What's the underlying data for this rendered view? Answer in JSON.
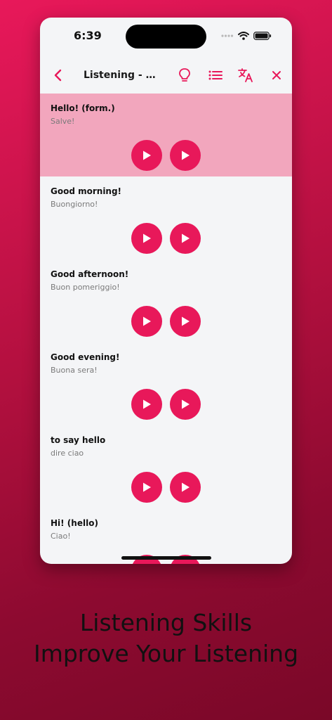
{
  "status": {
    "time": "6:39"
  },
  "nav": {
    "title": "Listening - To..."
  },
  "items": [
    {
      "phrase": "Hello! (form.)",
      "translation": "Salve!"
    },
    {
      "phrase": "Good morning!",
      "translation": "Buongiorno!"
    },
    {
      "phrase": "Good afternoon!",
      "translation": "Buon pomeriggio!"
    },
    {
      "phrase": "Good evening!",
      "translation": "Buona sera!"
    },
    {
      "phrase": "to say hello",
      "translation": "dire ciao"
    },
    {
      "phrase": "Hi! (hello)",
      "translation": "Ciao!"
    }
  ],
  "caption": {
    "line1": "Listening Skills",
    "line2": "Improve Your Listening"
  },
  "colors": {
    "accent": "#e8185a",
    "highlight": "#f2a6bd",
    "background": "#b3103f"
  },
  "icons": [
    "back-chevron-icon",
    "lightbulb-icon",
    "list-icon",
    "translate-icon",
    "close-icon",
    "play-icon"
  ]
}
